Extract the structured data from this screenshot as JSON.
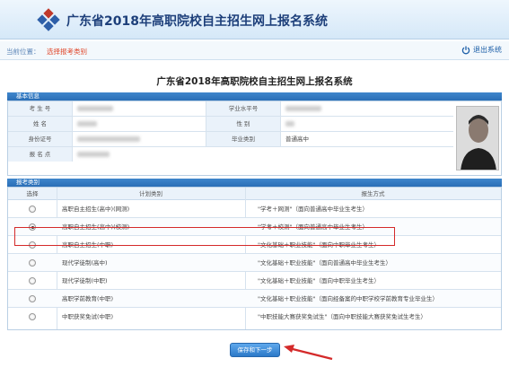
{
  "header": {
    "system_title": "广东省2018年高职院校自主招生网上报名系统"
  },
  "crumb": {
    "label": "当前位置：",
    "current": "选择报考类别",
    "logout": "退出系统"
  },
  "page_title": "广东省2018年高职院校自主招生网上报名系统",
  "basic_info": {
    "section_title": "基本信息",
    "labels": {
      "exam_no": "考 生 号",
      "name": "姓    名",
      "id_no": "身份证号",
      "site": "报 名 点",
      "level_no": "学业水平号",
      "gender": "性    别",
      "grad_type": "毕业类别"
    },
    "values": {
      "grad_type": "普通高中"
    }
  },
  "categories": {
    "section_title": "报考类别",
    "headers": {
      "select": "选择",
      "plan": "计划类别",
      "method": "报生方式"
    },
    "rows": [
      {
        "plan": "高职自主招生(高中)(网测)",
        "method": "\"学考＋网测\"（面向普通高中毕业生考生）",
        "checked": false
      },
      {
        "plan": "高职自主招生(高中)(校测)",
        "method": "\"学考＋校测\"（面向普通高中毕业生考生）",
        "checked": true
      },
      {
        "plan": "高职自主招生(中职)",
        "method": "\"文化基础＋职业技能\"（面向中职毕业生考生）",
        "checked": false
      },
      {
        "plan": "现代学徒制(高中)",
        "method": "\"文化基础＋职业技能\"（面向普通高中毕业生考生）",
        "checked": false
      },
      {
        "plan": "现代学徒制(中职)",
        "method": "\"文化基础＋职业技能\"（面向中职毕业生考生）",
        "checked": false
      },
      {
        "plan": "高职学前教育(中职)",
        "method": "\"文化基础＋职业技能\"（面向经备案的中职学校学前教育专业毕业生）",
        "checked": false
      },
      {
        "plan": "中职获奖免试(中职)",
        "method": "\"中职技能大赛获奖免试生\"（面向中职技能大赛获奖免试生考生）",
        "checked": false
      }
    ]
  },
  "save_button": "保存和下一步",
  "colors": {
    "accent": "#2a6eb6",
    "highlight": "#d42a2a",
    "title": "#1d3f7a"
  }
}
